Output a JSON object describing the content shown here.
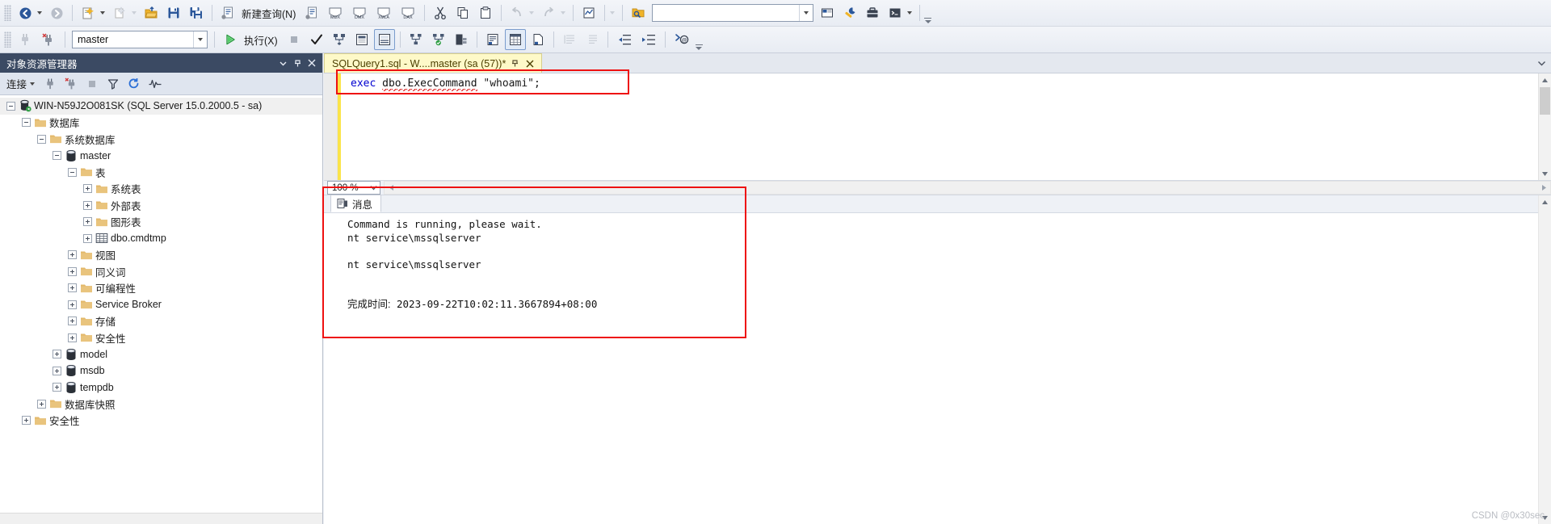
{
  "toolbar_row1": {
    "items": [
      {
        "name": "navigate-backward-button",
        "icon": "arrow-left-circle-icon",
        "has_caret": true,
        "label": ""
      },
      {
        "name": "navigate-forward-button",
        "icon": "arrow-right-circle-icon",
        "has_caret": false,
        "label": ""
      },
      {
        "name": "new-project-button",
        "icon": "new-project-icon",
        "has_caret": true,
        "label": ""
      },
      {
        "name": "add-new-item-button",
        "icon": "add-item-icon",
        "has_caret": true,
        "label": ""
      },
      {
        "name": "open-file-button",
        "icon": "open-folder-icon",
        "has_caret": false,
        "label": ""
      },
      {
        "name": "save-button",
        "icon": "save-disk-icon",
        "has_caret": false,
        "label": ""
      },
      {
        "name": "save-all-button",
        "icon": "save-all-icon",
        "has_caret": false,
        "label": ""
      },
      {
        "name": "new-query-button",
        "icon": "new-query-icon",
        "has_caret": false,
        "label": "新建查询(N)"
      },
      {
        "name": "new-query-with-current-connection-button",
        "icon": "query-doc-icon",
        "has_caret": false,
        "label": ""
      },
      {
        "name": "new-mdx-query-button",
        "icon": "mdx-query-icon",
        "has_caret": false,
        "label": ""
      },
      {
        "name": "new-dmx-query-button",
        "icon": "dmx-query-icon",
        "has_caret": false,
        "label": ""
      },
      {
        "name": "new-xmla-query-button",
        "icon": "xmla-query-icon",
        "has_caret": false,
        "label": ""
      },
      {
        "name": "new-dax-query-button",
        "icon": "dax-query-icon",
        "has_caret": false,
        "label": ""
      },
      {
        "name": "cut-button",
        "icon": "scissors-icon",
        "has_caret": false,
        "label": ""
      },
      {
        "name": "copy-button",
        "icon": "copy-icon",
        "has_caret": false,
        "label": ""
      },
      {
        "name": "paste-button",
        "icon": "paste-icon",
        "has_caret": false,
        "label": ""
      },
      {
        "name": "undo-button",
        "icon": "undo-arrow-icon",
        "has_caret": true,
        "label": ""
      },
      {
        "name": "redo-button",
        "icon": "redo-arrow-icon",
        "has_caret": true,
        "label": ""
      },
      {
        "name": "activity-monitor-button",
        "icon": "activity-monitor-icon",
        "has_caret": false,
        "label": ""
      },
      {
        "name": "toolbar-overflow-button",
        "icon": "chevron-down-icon",
        "has_caret": false,
        "label": ""
      },
      {
        "name": "quick-find-button",
        "icon": "find-folder-icon",
        "has_caret": false,
        "label": ""
      }
    ],
    "search_box": {
      "name": "quick-launch-search",
      "value": "",
      "placeholder": ""
    }
  },
  "toolbar_row2": {
    "connect_icon": "connect-plug-icon",
    "disconnect_icon": "disconnect-plug-icon",
    "database_selector": {
      "name": "database-selector",
      "value": "master"
    },
    "execute_label": "执行(X)",
    "items": [
      {
        "name": "execute-button",
        "icon": "play-triangle-icon",
        "label": "执行(X)"
      },
      {
        "name": "stop-button",
        "icon": "stop-square-icon",
        "label": ""
      },
      {
        "name": "parse-query-button",
        "icon": "checkmark-icon",
        "label": ""
      },
      {
        "name": "display-estimated-plan-button",
        "icon": "estimated-plan-icon",
        "label": ""
      },
      {
        "name": "query-options-button",
        "icon": "query-options-icon",
        "label": ""
      },
      {
        "name": "include-client-statistics-button",
        "icon": "client-statistics-icon",
        "label": ""
      },
      {
        "name": "include-actual-plan-button",
        "icon": "actual-plan-icon",
        "label": ""
      },
      {
        "name": "include-live-stats-button",
        "icon": "live-stats-icon",
        "label": ""
      },
      {
        "name": "specify-values-button",
        "icon": "specify-values-icon",
        "label": ""
      },
      {
        "name": "results-to-text-button",
        "icon": "results-to-text-icon",
        "label": ""
      },
      {
        "name": "results-to-grid-button",
        "icon": "results-to-grid-icon",
        "label": ""
      },
      {
        "name": "results-to-file-button",
        "icon": "results-to-file-icon",
        "label": ""
      },
      {
        "name": "comment-lines-button",
        "icon": "comment-lines-icon",
        "label": ""
      },
      {
        "name": "uncomment-lines-button",
        "icon": "uncomment-lines-icon",
        "label": ""
      },
      {
        "name": "decrease-indent-button",
        "icon": "decrease-indent-icon",
        "label": ""
      },
      {
        "name": "increase-indent-button",
        "icon": "increase-indent-icon",
        "label": ""
      },
      {
        "name": "sqlcmd-mode-button",
        "icon": "sqlcmd-at-icon",
        "label": ""
      }
    ]
  },
  "object_explorer": {
    "title": "对象资源管理器",
    "titlebar_buttons": [
      {
        "name": "oe-window-dropdown-button",
        "icon": "chevron-down-icon"
      },
      {
        "name": "oe-pin-button",
        "icon": "pin-icon"
      },
      {
        "name": "oe-close-button",
        "icon": "close-x-icon"
      }
    ],
    "toolbar": {
      "connect_label": "连接",
      "buttons": [
        {
          "name": "oe-connect-button",
          "icon": "connect-plug-icon"
        },
        {
          "name": "oe-disconnect-button",
          "icon": "disconnect-plug-icon"
        },
        {
          "name": "oe-stop-button",
          "icon": "stop-square-icon"
        },
        {
          "name": "oe-filter-button",
          "icon": "funnel-filter-icon"
        },
        {
          "name": "oe-refresh-button",
          "icon": "refresh-circular-icon"
        },
        {
          "name": "oe-activity-button",
          "icon": "activity-pulse-icon"
        }
      ]
    },
    "tree": [
      {
        "label": "WIN-N59J2O081SK (SQL Server 15.0.2000.5 - sa)",
        "depth": 0,
        "state": "expanded",
        "icon": "server-icon",
        "selected": true
      },
      {
        "label": "数据库",
        "depth": 1,
        "state": "expanded",
        "icon": "folder-icon",
        "selected": false
      },
      {
        "label": "系统数据库",
        "depth": 2,
        "state": "expanded",
        "icon": "folder-icon",
        "selected": false
      },
      {
        "label": "master",
        "depth": 3,
        "state": "expanded",
        "icon": "database-icon",
        "selected": false
      },
      {
        "label": "表",
        "depth": 4,
        "state": "expanded",
        "icon": "folder-icon",
        "selected": false
      },
      {
        "label": "系统表",
        "depth": 5,
        "state": "collapsed",
        "icon": "folder-icon",
        "selected": false
      },
      {
        "label": "外部表",
        "depth": 5,
        "state": "collapsed",
        "icon": "folder-icon",
        "selected": false
      },
      {
        "label": "图形表",
        "depth": 5,
        "state": "collapsed",
        "icon": "folder-icon",
        "selected": false
      },
      {
        "label": "dbo.cmdtmp",
        "depth": 5,
        "state": "collapsed",
        "icon": "table-icon",
        "selected": false
      },
      {
        "label": "视图",
        "depth": 4,
        "state": "collapsed",
        "icon": "folder-icon",
        "selected": false
      },
      {
        "label": "同义词",
        "depth": 4,
        "state": "collapsed",
        "icon": "folder-icon",
        "selected": false
      },
      {
        "label": "可编程性",
        "depth": 4,
        "state": "collapsed",
        "icon": "folder-icon",
        "selected": false
      },
      {
        "label": "Service Broker",
        "depth": 4,
        "state": "collapsed",
        "icon": "folder-icon",
        "selected": false
      },
      {
        "label": "存储",
        "depth": 4,
        "state": "collapsed",
        "icon": "folder-icon",
        "selected": false
      },
      {
        "label": "安全性",
        "depth": 4,
        "state": "collapsed",
        "icon": "folder-icon",
        "selected": false
      },
      {
        "label": "model",
        "depth": 3,
        "state": "collapsed",
        "icon": "database-icon",
        "selected": false
      },
      {
        "label": "msdb",
        "depth": 3,
        "state": "collapsed",
        "icon": "database-icon",
        "selected": false
      },
      {
        "label": "tempdb",
        "depth": 3,
        "state": "collapsed",
        "icon": "database-icon",
        "selected": false
      },
      {
        "label": "数据库快照",
        "depth": 2,
        "state": "collapsed",
        "icon": "folder-icon",
        "selected": false
      },
      {
        "label": "安全性",
        "depth": 1,
        "state": "collapsed",
        "icon": "folder-icon",
        "selected": false
      }
    ]
  },
  "editor": {
    "tab": {
      "title": "SQLQuery1.sql - W....master (sa (57))*",
      "pin_icon": "pin-icon",
      "close_icon": "close-x-icon"
    },
    "code": {
      "keyword": "exec",
      "identifier": "dbo.ExecCommand",
      "argument": "\"whoami\"",
      "terminator": ";"
    },
    "zoom_level": "100 %"
  },
  "results": {
    "tab_label": "消息",
    "tab_icon": "messages-icon",
    "lines": [
      "Command is running, please wait.",
      "nt service\\mssqlserver",
      "",
      "nt service\\mssqlserver",
      "",
      ""
    ],
    "completion_label": "完成时间:",
    "completion_time": "2023-09-22T10:02:11.3667894+08:00"
  },
  "watermark": "CSDN @0x30sec",
  "colors": {
    "annotation": "#ee1111",
    "tab_active_bg": "#fef9c8",
    "oe_title_bg": "#3b4a63",
    "keyword_blue": "#0000d0",
    "folder_tan": "#e3b96b"
  }
}
